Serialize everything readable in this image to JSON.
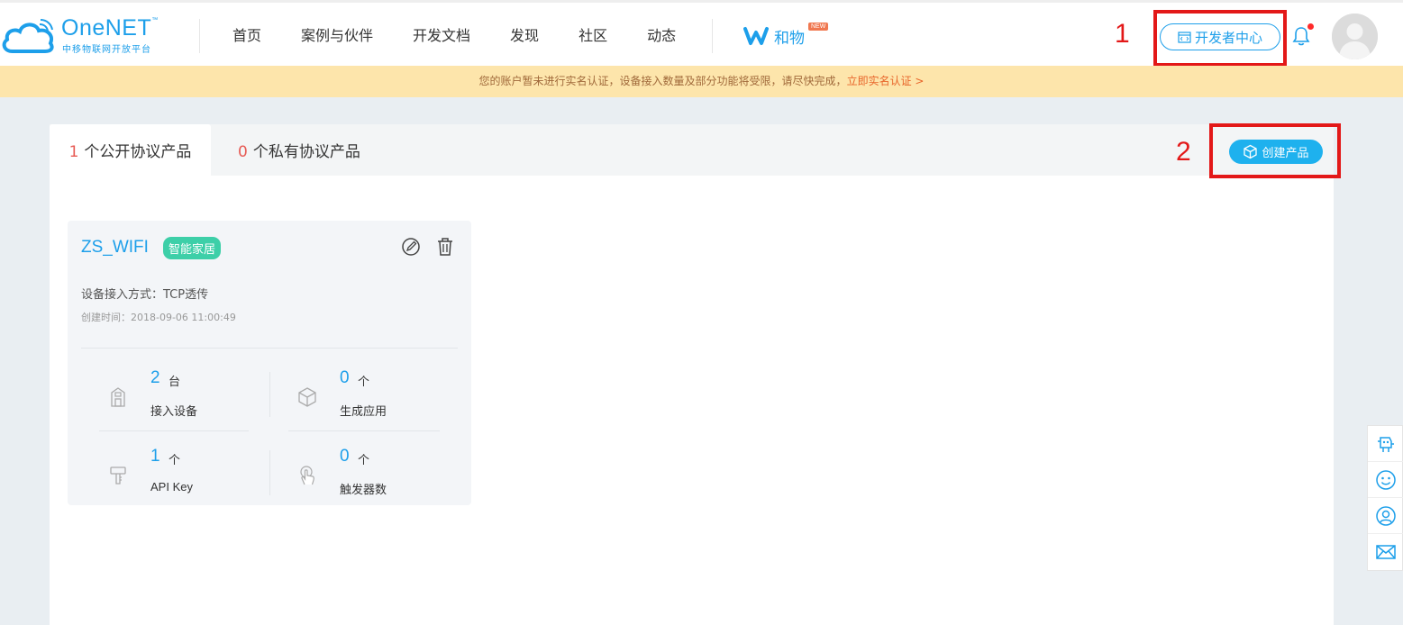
{
  "header": {
    "logo": {
      "name": "OneNET",
      "tm": "™",
      "subtitle": "中移物联网开放平台"
    },
    "nav": [
      "首页",
      "案例与伙伴",
      "开发文档",
      "发现",
      "社区",
      "动态"
    ],
    "hewu": {
      "label": "和物",
      "badge": "NEW"
    },
    "dev_center_label": "开发者中心"
  },
  "annotations": {
    "n1": "1",
    "n2": "2"
  },
  "notice": {
    "text": "您的账户暂未进行实名认证，设备接入数量及部分功能将受限，请尽快完成，",
    "link": "立即实名认证 >"
  },
  "tabs": [
    {
      "count": "1",
      "label": "个公开协议产品"
    },
    {
      "count": "0",
      "label": "个私有协议产品"
    }
  ],
  "create_button": "创建产品",
  "product": {
    "name": "ZS_WIFI",
    "tag": "智能家居",
    "access_method": "设备接入方式：TCP透传",
    "created": "创建时间：2018-09-06 11:00:49",
    "stats": [
      {
        "value": "2",
        "unit": "台",
        "label": "接入设备",
        "icon": "device-icon"
      },
      {
        "value": "0",
        "unit": "个",
        "label": "生成应用",
        "icon": "cube-icon"
      },
      {
        "value": "1",
        "unit": "个",
        "label": "API Key",
        "icon": "key-icon"
      },
      {
        "value": "0",
        "unit": "个",
        "label": "触发器数",
        "icon": "touch-icon"
      }
    ]
  },
  "colors": {
    "brand": "#1d9fea",
    "accent": "#1eb1ee",
    "tag": "#3dcfa8",
    "alert": "#e31818"
  },
  "sidebar": [
    "robot-icon",
    "smile-icon",
    "location-icon",
    "mail-icon"
  ]
}
